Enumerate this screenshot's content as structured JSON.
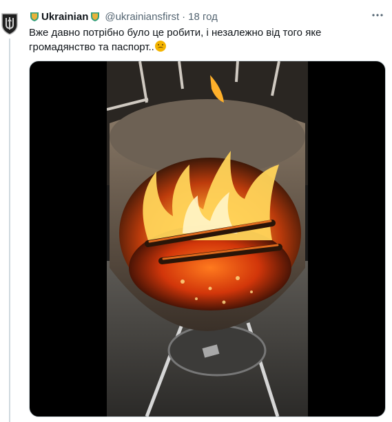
{
  "tweet": {
    "display_name": "Ukrainian",
    "handle": "@ukrainiansfirst",
    "separator": "·",
    "time": "18 год",
    "text": "Вже давно потрібно було це робити, і незалежно від того яке громадянство та паспорт..",
    "text_emoji": "angry-face-emoji"
  },
  "icons": {
    "avatar": "trident-shield-avatar",
    "badge_left": "shield-badge-icon",
    "badge_right": "shield-badge-icon",
    "more": "more-options-icon"
  },
  "colors": {
    "text": "#0f1419",
    "secondary": "#536471",
    "badge": "#e8b23a",
    "badge_accent": "#2f9e7a"
  }
}
